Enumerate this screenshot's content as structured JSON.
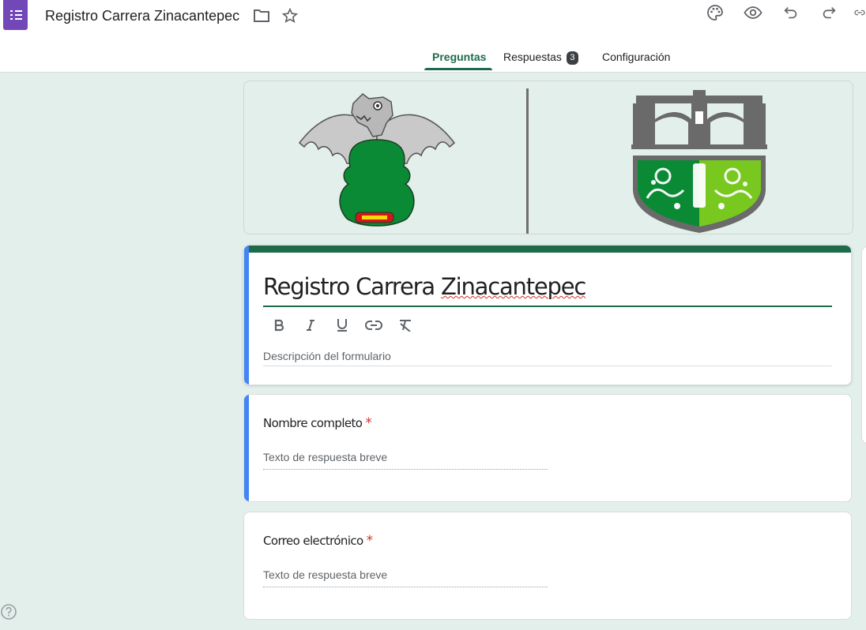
{
  "app": {
    "icon": "google-forms-icon",
    "title": "Registro Carrera Zinacantepec"
  },
  "toolbar": {
    "folder_icon": "folder-icon",
    "star_icon": "star-icon",
    "palette_icon": "palette-icon",
    "preview_icon": "eye-icon",
    "undo_icon": "undo-icon",
    "redo_icon": "redo-icon",
    "link_icon": "link-icon"
  },
  "tabs": [
    {
      "label": "Preguntas",
      "active": true
    },
    {
      "label": "Respuestas",
      "badge": "3"
    },
    {
      "label": "Configuración"
    }
  ],
  "form": {
    "header_image": "two-emblems: bat glyph and stone bridge shield",
    "title_part1": "Registro Carrera ",
    "title_part2": "Zinacantepec",
    "format_buttons": [
      "bold-icon",
      "italic-icon",
      "underline-icon",
      "link-icon",
      "clear-format-icon"
    ],
    "description_placeholder": "Descripción del formulario",
    "accent_color": "#1e6b4c",
    "focus_color": "#4285f4"
  },
  "questions": [
    {
      "title": "Nombre completo",
      "required_mark": "*",
      "placeholder": "Texto de respuesta breve"
    },
    {
      "title": "Correo electrónico",
      "required_mark": "*",
      "placeholder": "Texto de respuesta breve"
    }
  ],
  "footer": {
    "help_icon": "help-circle-icon"
  }
}
